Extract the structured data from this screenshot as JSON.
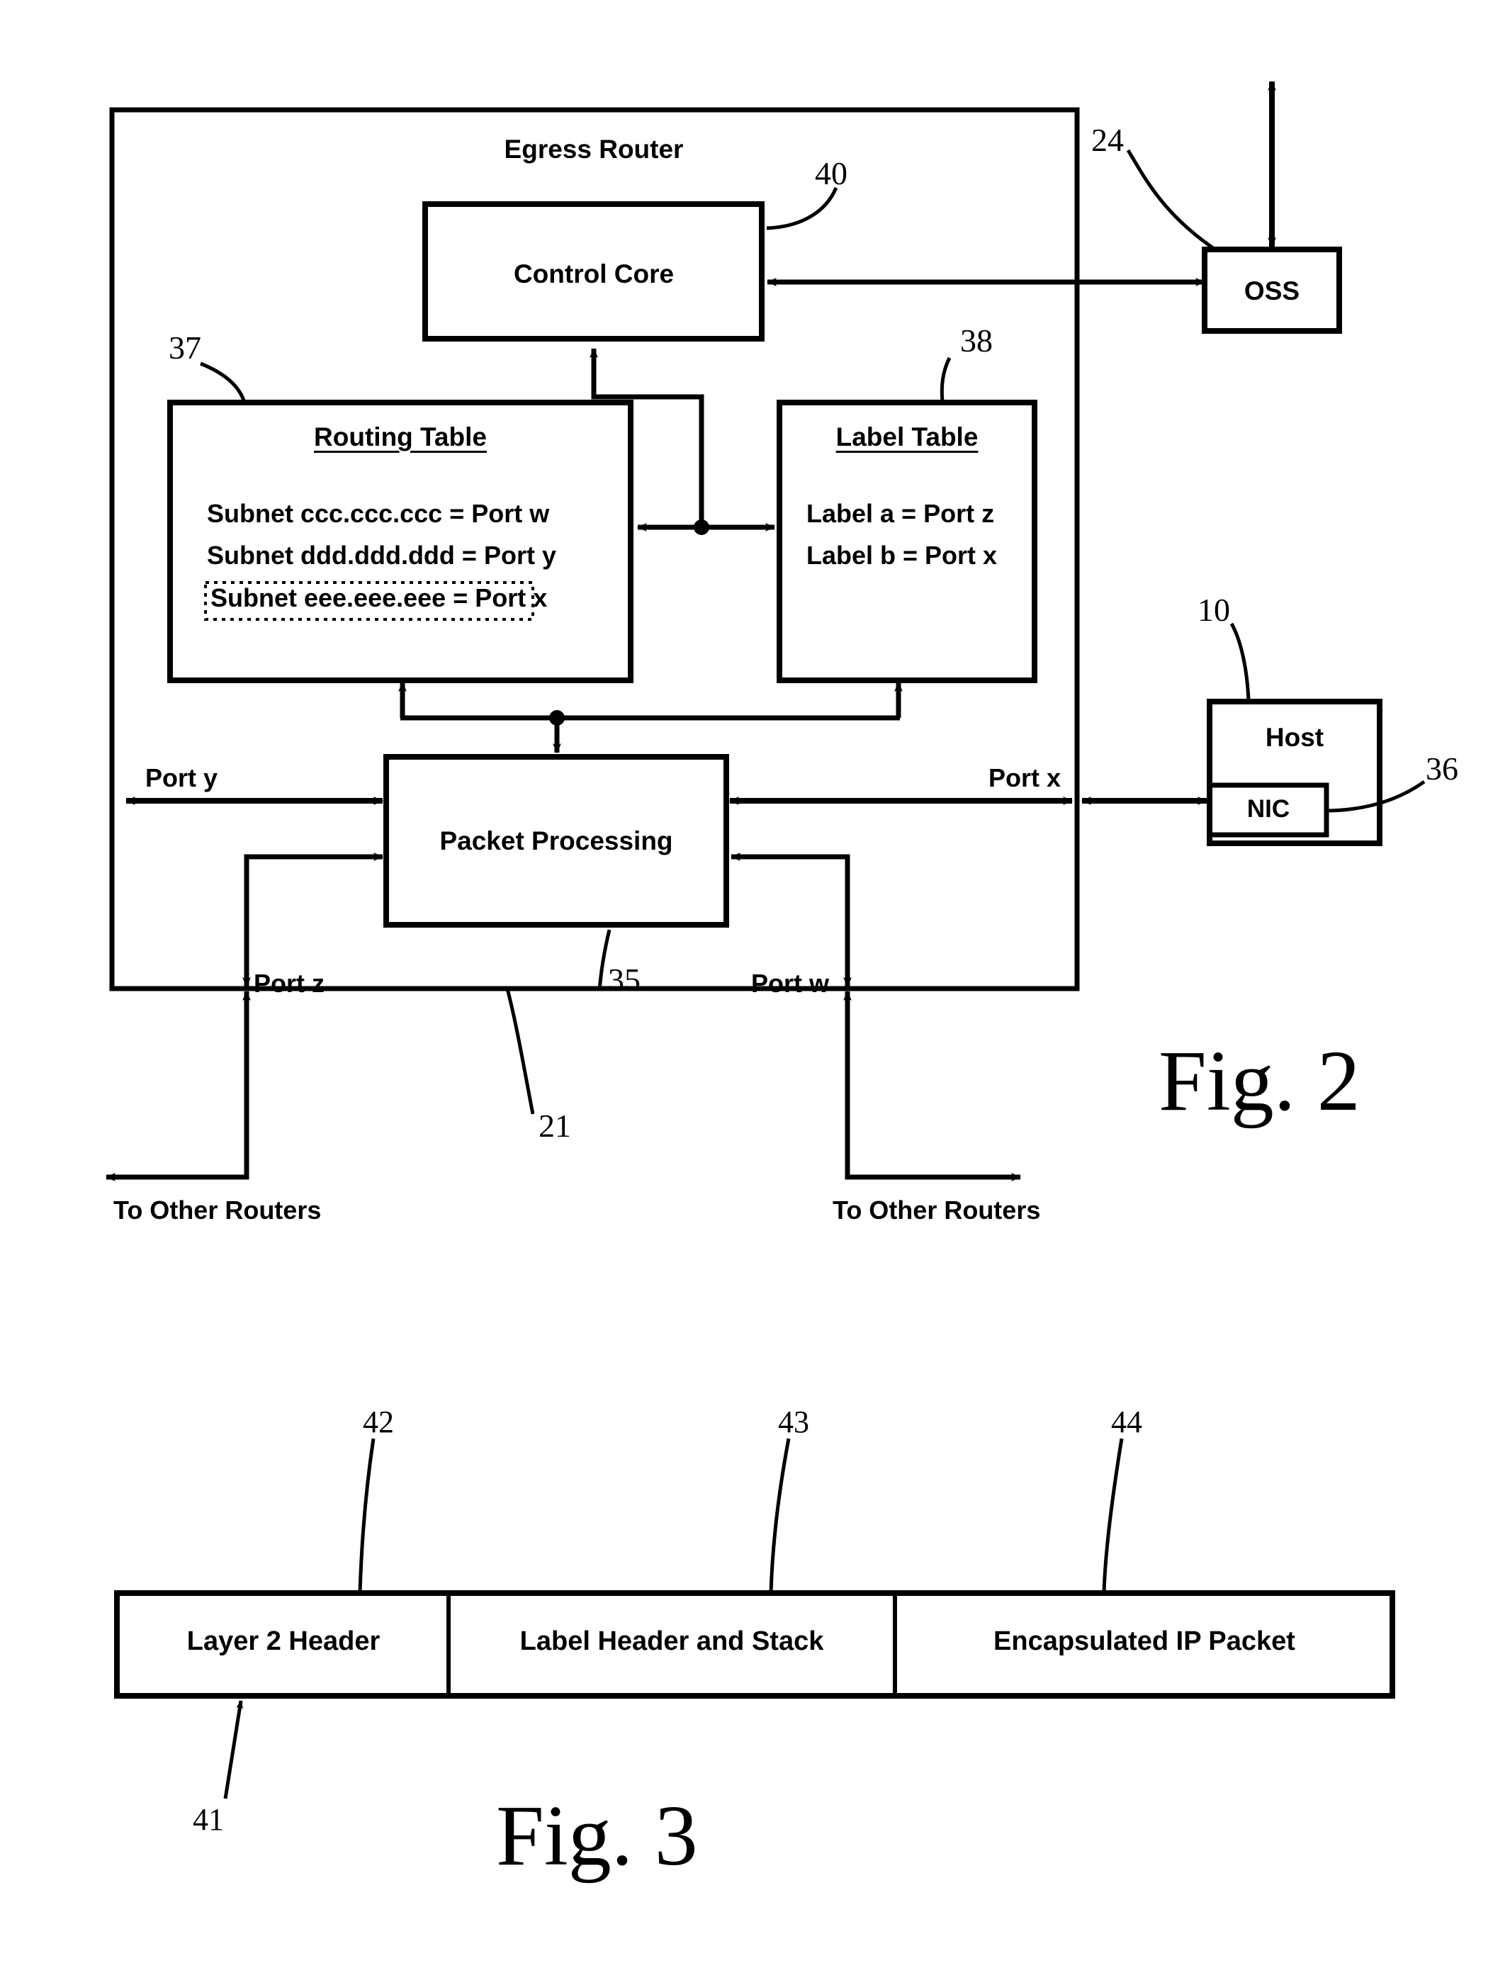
{
  "figure2": {
    "title": "Egress Router",
    "ref_router": "21",
    "blocks": {
      "control_core": {
        "label": "Control Core",
        "ref": "40"
      },
      "routing_table": {
        "title": "Routing Table",
        "ref": "37",
        "rows": [
          "Subnet ccc.ccc.ccc =  Port w",
          "Subnet ddd.ddd.ddd = Port y",
          "Subnet eee.eee.eee = Port x"
        ],
        "highlighted_row_index": 2
      },
      "label_table": {
        "title": "Label Table",
        "ref": "38",
        "rows": [
          "Label a = Port z",
          "Label b = Port x"
        ]
      },
      "packet_processing": {
        "label": "Packet Processing",
        "ref": "35"
      },
      "oss": {
        "label": "OSS",
        "ref": "24"
      },
      "host": {
        "label": "Host",
        "ref": "10"
      },
      "nic": {
        "label": "NIC",
        "ref": "36"
      }
    },
    "ports": {
      "port_y": "Port y",
      "port_x": "Port x",
      "port_z": "Port z",
      "port_w": "Port w"
    },
    "external": {
      "to_other_routers_left": "To Other Routers",
      "to_other_routers_right": "To Other Routers"
    },
    "caption": "Fig. 2"
  },
  "figure3": {
    "ref_packet": "41",
    "fields": [
      {
        "label": "Layer 2 Header",
        "ref": "42"
      },
      {
        "label": "Label Header and Stack",
        "ref": "43"
      },
      {
        "label": "Encapsulated IP Packet",
        "ref": "44"
      }
    ],
    "caption": "Fig. 3"
  }
}
